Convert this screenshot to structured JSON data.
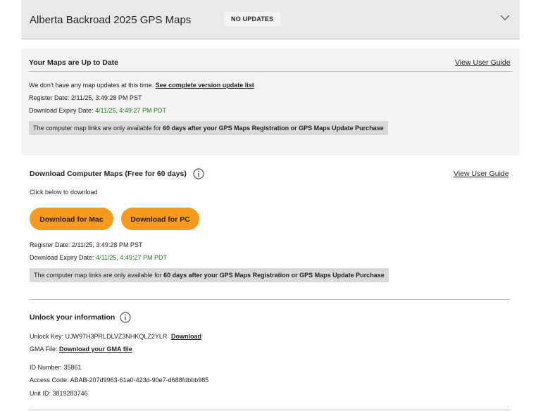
{
  "header": {
    "title": "Alberta Backroad 2025 GPS Maps",
    "badge": "NO UPDATES",
    "chevron_icon": "chevron-down-icon"
  },
  "status": {
    "title": "Your Maps are Up to Date",
    "guide_link": "View User Guide",
    "no_updates_text": "We don't have any map updates at this time.",
    "version_list_link": "See complete version update list",
    "register_label": "Register Date:",
    "register_value": "2/11/25, 3:49:28 PM PST",
    "expiry_label": "Download Expiry Date:",
    "expiry_value": "4/11/25, 4:49:27 PM PDT",
    "notice_prefix": "The computer map links are only available for",
    "notice_bold": "60 days after your GPS Maps Registration or GPS Maps Update Purchase"
  },
  "download": {
    "title": "Download Computer Maps (Free for 60 days)",
    "guide_link": "View User Guide",
    "instruction": "Click below to download",
    "mac_button": "Download for Mac",
    "pc_button": "Download for PC",
    "register_label": "Register Date:",
    "register_value": "2/11/25, 3:49:28 PM PST",
    "expiry_label": "Download Expiry Date:",
    "expiry_value": "4/11/25, 4:49:27 PM PDT",
    "notice_prefix": "The computer map links are only available for",
    "notice_bold": "60 days after your GPS Maps Registration or GPS Maps Update Purchase"
  },
  "unlock": {
    "title": "Unlock your information",
    "unlock_key_label": "Unlock Key:",
    "unlock_key_value": "UJW97H3PRLDLVZ3NHKQLZ2YLR",
    "unlock_download_link": "Download",
    "gma_label": "GMA File:",
    "gma_link": "Download your GMA file",
    "id_label": "ID Number:",
    "id_value": "35861",
    "access_label": "Access Code:",
    "access_value": "ABAB-207d9963-61a0-423d-90e7-d688fdbbb985",
    "unit_label": "Unit ID:",
    "unit_value": "3819283746"
  },
  "colors": {
    "button_orange": "#f89a1c",
    "expiry_green": "#1e7b1e"
  }
}
